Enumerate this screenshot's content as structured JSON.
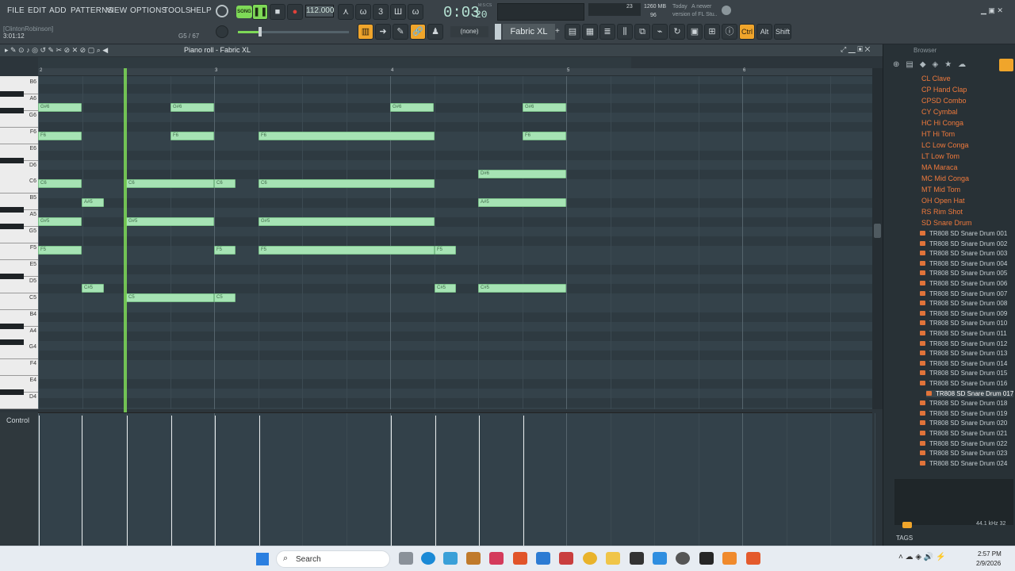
{
  "menu": [
    "FILE",
    "EDIT",
    "ADD",
    "PATTERNS",
    "VIEW",
    "OPTIONS",
    "TOOLS",
    "HELP"
  ],
  "song_mode": "SONG",
  "tempo": "112.000",
  "time": {
    "main": "0:03",
    "sub": "20",
    "label": "M:S:CS"
  },
  "hint_line": "[ClintonRobinson]",
  "position": "3:01:12",
  "note_info": "G5 / 67",
  "cpu": {
    "value": "23",
    "mem": "1260 MB",
    "poly": "96"
  },
  "news": {
    "day": "Today",
    "line1": "A newer",
    "line2": "version of FL Stu.."
  },
  "channel_preset": "(none)",
  "channel_name": "Fabric XL",
  "toolbar_mods": [
    "Ctrl",
    "Alt",
    "Shift"
  ],
  "piano_roll_title": "Piano roll - Fabric XL",
  "ruler": [
    "2",
    "3",
    "4",
    "5",
    "6"
  ],
  "keys": [
    "B6",
    "A6",
    "G6",
    "F6",
    "E6",
    "D6",
    "C6",
    "B5",
    "A5",
    "G5",
    "F5",
    "E5",
    "D5",
    "C5",
    "B4",
    "A4",
    "G4",
    "F4",
    "E4",
    "D4"
  ],
  "notes": [
    {
      "label": "G#6",
      "row": 0,
      "start": 0,
      "len": 55
    },
    {
      "label": "G#6",
      "row": 0,
      "start": 167,
      "len": 55
    },
    {
      "label": "G#6",
      "row": 0,
      "start": 444,
      "len": 55
    },
    {
      "label": "G#6",
      "row": 0,
      "start": 611,
      "len": 55
    },
    {
      "label": "F6",
      "row": 3,
      "start": 0,
      "len": 55
    },
    {
      "label": "F6",
      "row": 3,
      "start": 167,
      "len": 55
    },
    {
      "label": "F6",
      "row": 3,
      "start": 278,
      "len": 222
    },
    {
      "label": "F6",
      "row": 3,
      "start": 611,
      "len": 55
    },
    {
      "label": "D#6",
      "row": 7,
      "start": 555,
      "len": 111
    },
    {
      "label": "C6",
      "row": 8,
      "start": 0,
      "len": 55
    },
    {
      "label": "C6",
      "row": 8,
      "start": 111,
      "len": 111
    },
    {
      "label": "C6",
      "row": 8,
      "start": 222,
      "len": 27
    },
    {
      "label": "C6",
      "row": 8,
      "start": 278,
      "len": 222
    },
    {
      "label": "A#5",
      "row": 10,
      "start": 55,
      "len": 28
    },
    {
      "label": "A#5",
      "row": 10,
      "start": 555,
      "len": 111
    },
    {
      "label": "G#5",
      "row": 12,
      "start": 0,
      "len": 55
    },
    {
      "label": "G#5",
      "row": 12,
      "start": 111,
      "len": 111
    },
    {
      "label": "G#5",
      "row": 12,
      "start": 278,
      "len": 222
    },
    {
      "label": "F5",
      "row": 15,
      "start": 0,
      "len": 55
    },
    {
      "label": "F5",
      "row": 15,
      "start": 222,
      "len": 27
    },
    {
      "label": "F5",
      "row": 15,
      "start": 278,
      "len": 222
    },
    {
      "label": "F5",
      "row": 15,
      "start": 500,
      "len": 27
    },
    {
      "label": "C#5",
      "row": 19,
      "start": 55,
      "len": 28
    },
    {
      "label": "C#5",
      "row": 19,
      "start": 500,
      "len": 27
    },
    {
      "label": "C#5",
      "row": 19,
      "start": 555,
      "len": 111
    },
    {
      "label": "C5",
      "row": 20,
      "start": 111,
      "len": 111
    },
    {
      "label": "C5",
      "row": 20,
      "start": 222,
      "len": 27
    }
  ],
  "control_label": "Control",
  "browser": {
    "title": "Browser",
    "folders": [
      "CL Clave",
      "CP Hand Clap",
      "CPSD Combo",
      "CY Cymbal",
      "HC Hi Conga",
      "HT Hi Tom",
      "LC Low Conga",
      "LT Low Tom",
      "MA Maraca",
      "MC Mid Conga",
      "MT Mid Tom",
      "OH Open Hat",
      "RS Rim Shot",
      "SD Snare Drum"
    ],
    "files": [
      "TR808 SD Snare Drum 001",
      "TR808 SD Snare Drum 002",
      "TR808 SD Snare Drum 003",
      "TR808 SD Snare Drum 004",
      "TR808 SD Snare Drum 005",
      "TR808 SD Snare Drum 006",
      "TR808 SD Snare Drum 007",
      "TR808 SD Snare Drum 008",
      "TR808 SD Snare Drum 009",
      "TR808 SD Snare Drum 010",
      "TR808 SD Snare Drum 011",
      "TR808 SD Snare Drum 012",
      "TR808 SD Snare Drum 013",
      "TR808 SD Snare Drum 014",
      "TR808 SD Snare Drum 015",
      "TR808 SD Snare Drum 016",
      "TR808 SD Snare Drum 017",
      "TR808 SD Snare Drum 018",
      "TR808 SD Snare Drum 019",
      "TR808 SD Snare Drum 020",
      "TR808 SD Snare Drum 021",
      "TR808 SD Snare Drum 022",
      "TR808 SD Snare Drum 023",
      "TR808 SD Snare Drum 024"
    ],
    "selected_file": "TR808 SD Snare Drum 017",
    "sample_info": "44.1 kHz 32",
    "tags_label": "TAGS"
  },
  "taskbar": {
    "search": "Search",
    "time": "2:57 PM",
    "date": "2/9/2026"
  },
  "colors": {
    "note": "#a6e3b4",
    "playhead": "#7ed957",
    "folder": "#f07a3c",
    "accent": "#f0a52b"
  }
}
